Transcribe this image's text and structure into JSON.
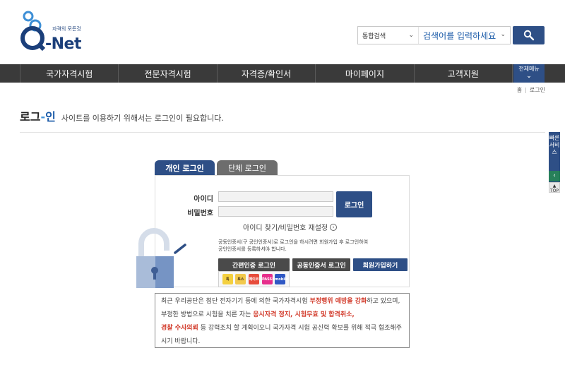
{
  "logo": {
    "tagline": "자격의 모든것",
    "wordmark": "-Net"
  },
  "search": {
    "category": "통합검색",
    "placeholder": "검색어를 입력하세요"
  },
  "nav": {
    "items": [
      "국가자격시험",
      "전문자격시험",
      "자격증/확인서",
      "마이페이지",
      "고객지원"
    ],
    "all_menu": "전체메뉴"
  },
  "breadcrumb": {
    "home": "홈",
    "current": "로그인"
  },
  "page": {
    "title_a": "로그",
    "title_dash": "-",
    "title_b": "인",
    "desc": "사이트를 이용하기 위해서는 로그인이 필요합니다."
  },
  "quick": {
    "label": "빠른서비스",
    "top": "TOP"
  },
  "tabs": {
    "personal": "개인 로그인",
    "group": "단체 로그인"
  },
  "form": {
    "id_label": "아이디",
    "pw_label": "비밀번호",
    "login_button": "로그인",
    "find_link": "아이디 찾기/비밀번호 재설정"
  },
  "cert": {
    "note_line1": "공동인증서(구 공인인증서)로 로그인을 하시려면 회원가입 후 로그인하여",
    "note_line2": "공인인증서를 등록하셔야 합니다.",
    "simple_button": "간편인증 로그인",
    "cert_button": "공동인증서 로그인",
    "join_button": "회원가입하기"
  },
  "providers": [
    {
      "name": "톡",
      "color": "#f4d03f",
      "text_color": "#3b2a1a"
    },
    {
      "name": "토스",
      "color": "#f2c94c",
      "text_color": "#3b2a1a"
    },
    {
      "name": "페이코",
      "color": "#e74c3c",
      "text_color": "#ffffff"
    },
    {
      "name": "PASS",
      "color": "#e62e8b",
      "text_color": "#ffffff"
    },
    {
      "name": "Kmobile",
      "color": "#2f58c4",
      "text_color": "#ffffff"
    }
  ],
  "notice": {
    "p1": "최근 우리공단은 첨단 전자기기 등에 의한 국가자격시험 ",
    "r1": "부정행위 예방을 강화",
    "p2": "하고 있으며, 부정한 방법으로 시험을 치른 자는 ",
    "r2": "응시자격 정지, 시험무효 및 합격취소,",
    "r3": "경찰 수사의뢰",
    "p3": " 등 강력조치 할 계획이오니 국가자격 시험 공신력 확보를 위해 적극 협조해주시기 바랍니다."
  },
  "colors": {
    "primary": "#2e4f86",
    "nav_bg": "#3a3a3a",
    "accent_red": "#d23a2a"
  }
}
